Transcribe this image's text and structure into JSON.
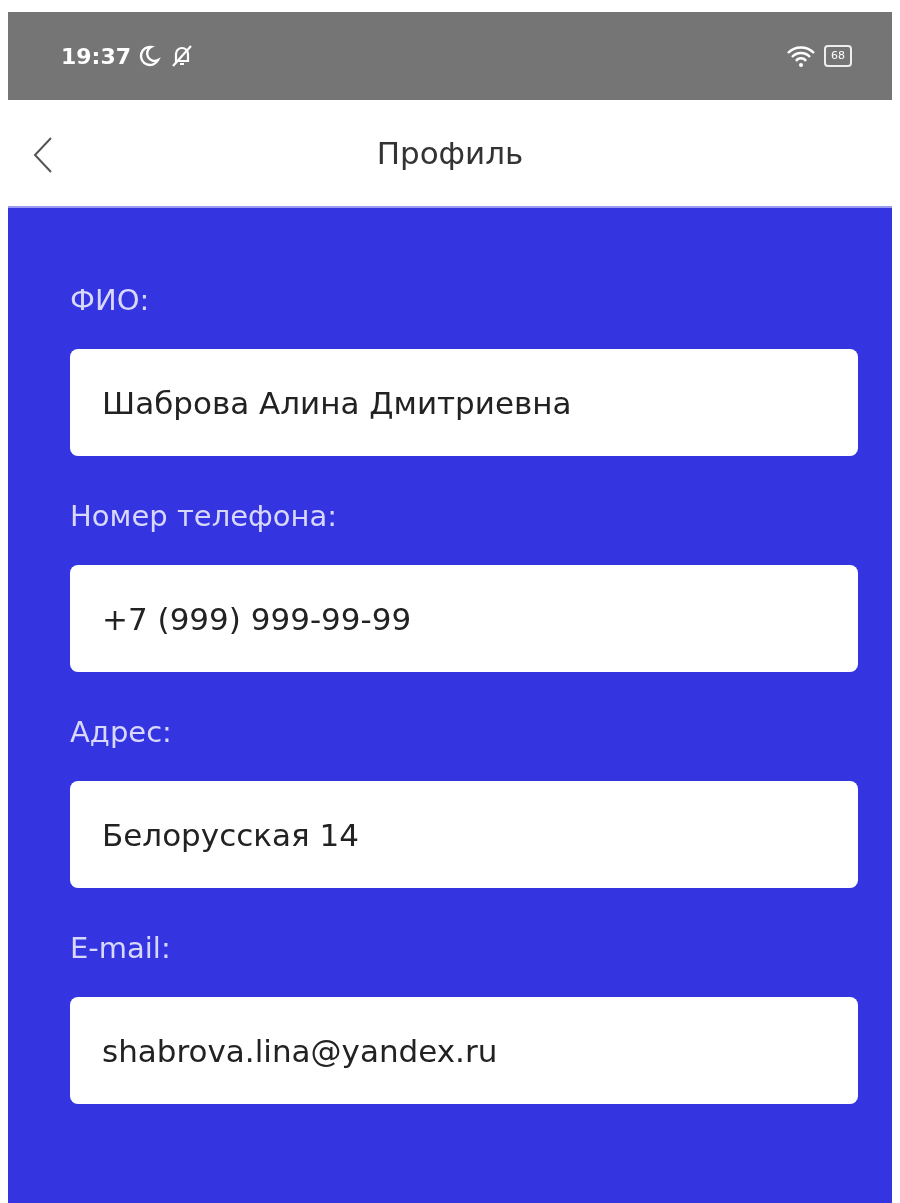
{
  "status_bar": {
    "time": "19:37",
    "battery": "68"
  },
  "header": {
    "title": "Профиль"
  },
  "fields": [
    {
      "label": "ФИО:",
      "value": "Шаброва Алина Дмитриевна"
    },
    {
      "label": "Номер телефона:",
      "value": "+7 (999) 999-99-99"
    },
    {
      "label": "Адрес:",
      "value": "Белорусская 14"
    },
    {
      "label": "E-mail:",
      "value": "shabrova.lina@yandex.ru"
    }
  ]
}
